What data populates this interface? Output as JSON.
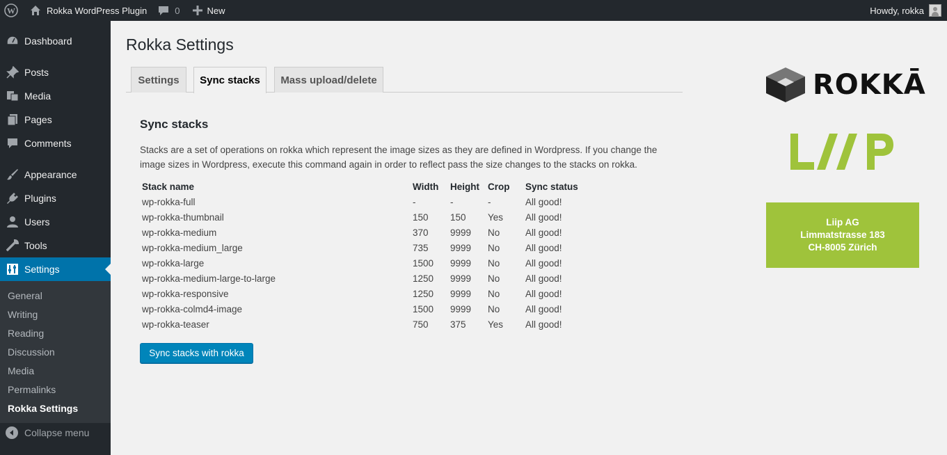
{
  "adminbar": {
    "site_name": "Rokka WordPress Plugin",
    "comments_count": "0",
    "new_label": "New",
    "howdy": "Howdy, rokka"
  },
  "sidebar": {
    "items": [
      {
        "label": "Dashboard",
        "icon": "dashboard-icon"
      },
      {
        "label": "Posts",
        "icon": "pin-icon"
      },
      {
        "label": "Media",
        "icon": "media-icon"
      },
      {
        "label": "Pages",
        "icon": "pages-icon"
      },
      {
        "label": "Comments",
        "icon": "comment-icon"
      },
      {
        "label": "Appearance",
        "icon": "brush-icon"
      },
      {
        "label": "Plugins",
        "icon": "plug-icon"
      },
      {
        "label": "Users",
        "icon": "user-icon"
      },
      {
        "label": "Tools",
        "icon": "wrench-icon"
      },
      {
        "label": "Settings",
        "icon": "settings-icon"
      }
    ],
    "submenu": [
      "General",
      "Writing",
      "Reading",
      "Discussion",
      "Media",
      "Permalinks",
      "Rokka Settings"
    ],
    "collapse": "Collapse menu"
  },
  "page": {
    "title": "Rokka Settings",
    "tabs": [
      "Settings",
      "Sync stacks",
      "Mass upload/delete"
    ],
    "active_tab": "Sync stacks",
    "section_title": "Sync stacks",
    "description": "Stacks are a set of operations on rokka which represent the image sizes as they are defined in Wordpress. If you change the image sizes in Wordpress, execute this command again in order to reflect pass the size changes to the stacks on rokka.",
    "button": "Sync stacks with rokka"
  },
  "table": {
    "headers": [
      "Stack name",
      "Width",
      "Height",
      "Crop",
      "Sync status"
    ],
    "rows": [
      [
        "wp-rokka-full",
        "-",
        "-",
        "-",
        "All good!"
      ],
      [
        "wp-rokka-thumbnail",
        "150",
        "150",
        "Yes",
        "All good!"
      ],
      [
        "wp-rokka-medium",
        "370",
        "9999",
        "No",
        "All good!"
      ],
      [
        "wp-rokka-medium_large",
        "735",
        "9999",
        "No",
        "All good!"
      ],
      [
        "wp-rokka-large",
        "1500",
        "9999",
        "No",
        "All good!"
      ],
      [
        "wp-rokka-medium-large-to-large",
        "1250",
        "9999",
        "No",
        "All good!"
      ],
      [
        "wp-rokka-responsive",
        "1250",
        "9999",
        "No",
        "All good!"
      ],
      [
        "wp-rokka-colmd4-image",
        "1500",
        "9999",
        "No",
        "All good!"
      ],
      [
        "wp-rokka-teaser",
        "750",
        "375",
        "Yes",
        "All good!"
      ]
    ]
  },
  "branding": {
    "rokka_logo_text": "ROKKĀ",
    "liip_logo_text": "LIIP",
    "address": [
      "Liip AG",
      "Limmatstrasse 183",
      "CH-8005 Zürich"
    ],
    "liip_green": "#9fc33b",
    "accent": "#0073aa"
  }
}
